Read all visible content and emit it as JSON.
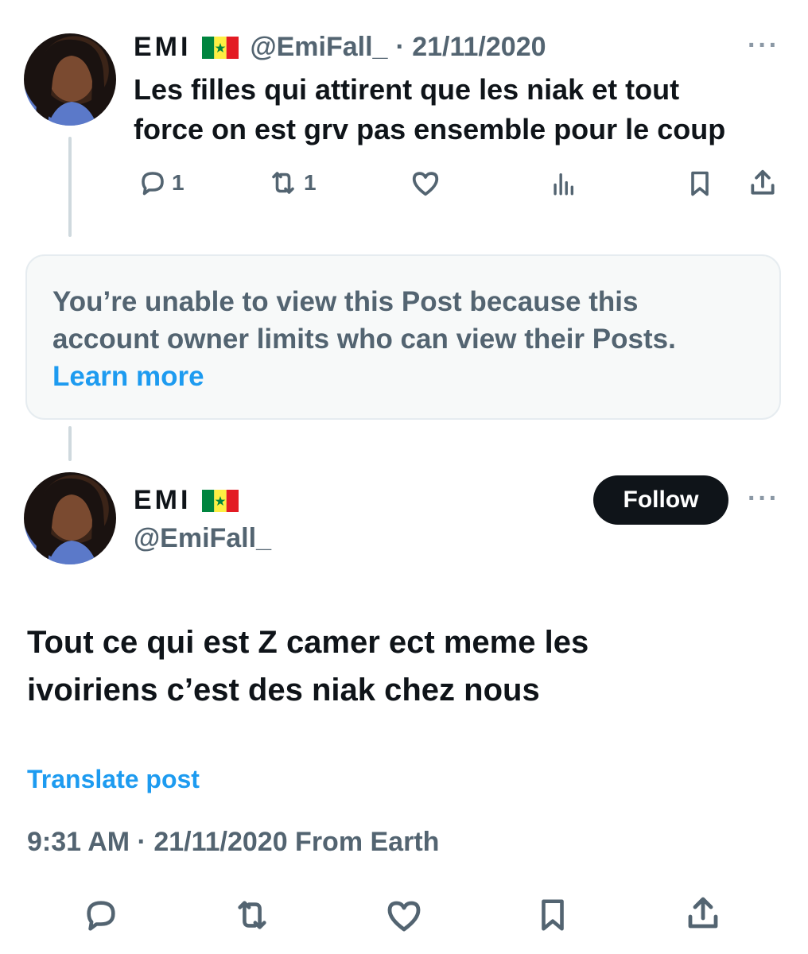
{
  "reply": {
    "name": "EMI",
    "handle": "@EmiFall_",
    "date": "· 21/11/2020",
    "text_line1": "Les filles qui attirent que les niak  et tout",
    "text_line2": "force on est grv pas ensemble pour le coup",
    "replies": "1",
    "reposts": "1"
  },
  "notice": {
    "line1": "You’re unable to view this Post because this",
    "line2": "account owner limits who can view their Posts.",
    "link": "Learn more"
  },
  "main": {
    "name": "EMI",
    "handle": "@EmiFall_",
    "follow_label": "Follow",
    "text_line1": "Tout ce qui est Z camer ect meme les",
    "text_line2": "ivoiriens c’est des niak chez nous",
    "translate": "Translate post",
    "meta": "9:31 AM · 21/11/2020 From Earth"
  },
  "more_label": "···",
  "icons": [
    "reply-icon",
    "repost-icon",
    "like-icon",
    "views-icon",
    "bookmark-icon",
    "share-icon",
    "more-icon",
    "senegal-flag-icon"
  ],
  "colors": {
    "accent": "#1d9bf0",
    "text": "#0f1419",
    "muted": "#536471",
    "notice_bg": "#f7f9f9"
  }
}
